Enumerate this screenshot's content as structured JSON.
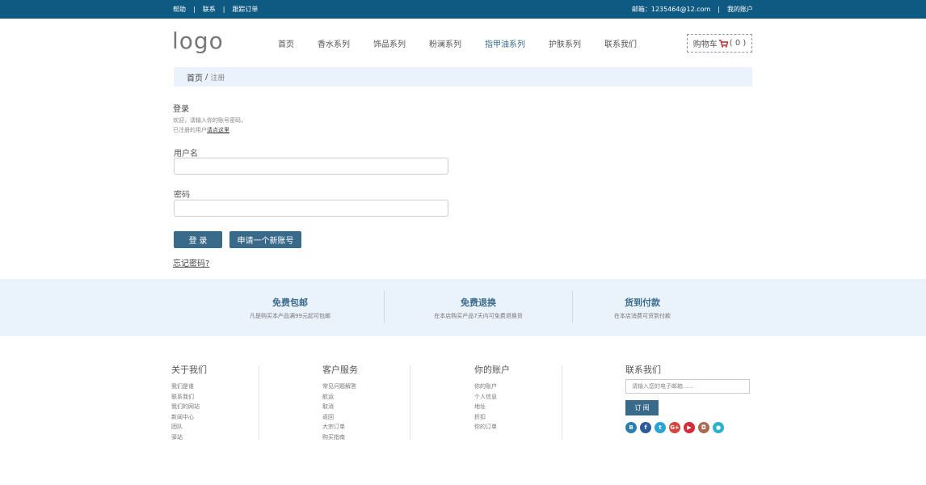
{
  "topbar": {
    "links": [
      "帮助",
      "联系",
      "跟踪订单"
    ],
    "email": "邮箱：1235464@12.com",
    "account": "我的账户"
  },
  "header": {
    "logo": "logo",
    "nav": [
      {
        "label": "首页"
      },
      {
        "label": "香水系列"
      },
      {
        "label": "饰品系列"
      },
      {
        "label": "粉澜系列"
      },
      {
        "label": "指甲油系列"
      },
      {
        "label": "护肤系列"
      },
      {
        "label": "联系我们"
      }
    ],
    "cart_label": "购物车",
    "cart_count": "( 0 )"
  },
  "breadcrumb": {
    "home": "首页",
    "sep": "/",
    "current": "注册"
  },
  "login": {
    "title": "登录",
    "desc1": "欢迎，请输入你的账号密码，",
    "desc2_prefix": "已注册的用户",
    "desc2_link": "请点这里",
    "username_label": "用户名",
    "password_label": "密码",
    "login_button": "登 录",
    "register_button": "申请一个新账号",
    "forgot": "忘记密码?"
  },
  "features": [
    {
      "title": "免费包邮",
      "sub": "凡是购买本产品满99元起可包邮"
    },
    {
      "title": "免费退换",
      "sub": "在本店购买产品7天内可免费退换货"
    },
    {
      "title": "货到付款",
      "sub": "在本店消费可货到付款"
    }
  ],
  "footer": {
    "about": {
      "title": "关于我们",
      "items": [
        "我们是谁",
        "联系我们",
        "我们的网站",
        "新闻中心",
        "团队",
        "驿站"
      ]
    },
    "service": {
      "title": "客户服务",
      "items": [
        "常见问题解答",
        "航运",
        "取消",
        "返回",
        "大宗订单",
        "购买指南"
      ]
    },
    "account": {
      "title": "你的账户",
      "items": [
        "你的账户",
        "个人信息",
        "地址",
        "折扣",
        "你的订单"
      ]
    },
    "contact": {
      "title": "联系我们",
      "email_placeholder": "请输入您的电子邮箱......",
      "subscribe": "订 阅",
      "socials": [
        {
          "icon": "blogger-icon",
          "glyph": "B",
          "color": "#2a7fb0"
        },
        {
          "icon": "facebook-icon",
          "glyph": "f",
          "color": "#2f5b9a"
        },
        {
          "icon": "twitter-icon",
          "glyph": "t",
          "color": "#2aa3d6"
        },
        {
          "icon": "google-plus-icon",
          "glyph": "G+",
          "color": "#d6453d"
        },
        {
          "icon": "youtube-icon",
          "glyph": "▶",
          "color": "#d32b3a"
        },
        {
          "icon": "instagram-icon",
          "glyph": "◘",
          "color": "#a86b52"
        },
        {
          "icon": "location-icon",
          "glyph": "●",
          "color": "#2ab3c9"
        }
      ]
    }
  }
}
